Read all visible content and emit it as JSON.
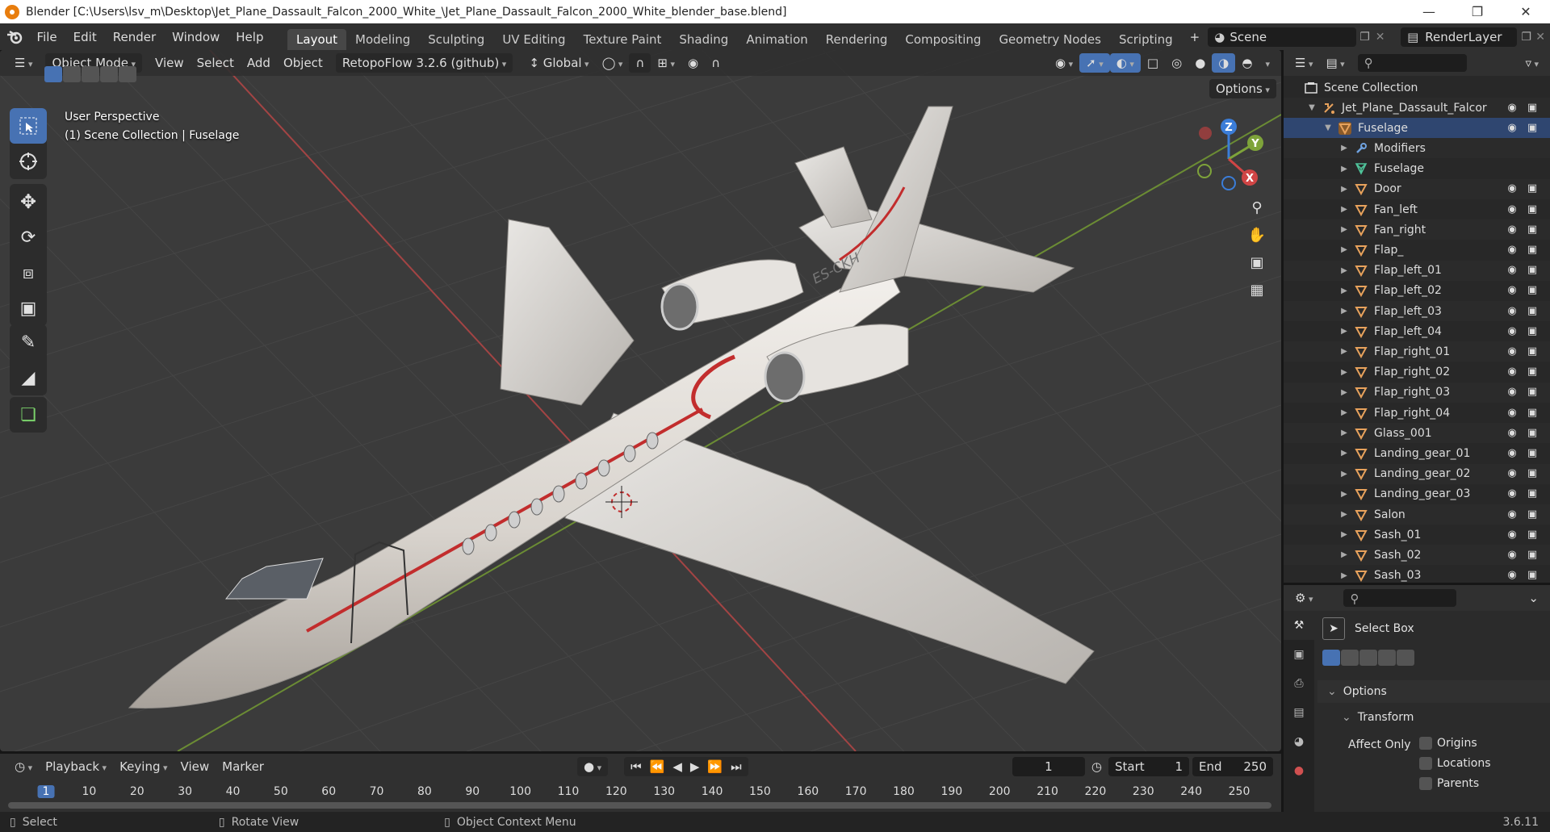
{
  "window": {
    "title": "Blender [C:\\Users\\lsv_m\\Desktop\\Jet_Plane_Dassault_Falcon_2000_White_\\Jet_Plane_Dassault_Falcon_2000_White_blender_base.blend]",
    "minimize": "—",
    "restore": "❐",
    "close": "✕"
  },
  "menus": [
    "File",
    "Edit",
    "Render",
    "Window",
    "Help"
  ],
  "workspaces": [
    "Layout",
    "Modeling",
    "Sculpting",
    "UV Editing",
    "Texture Paint",
    "Shading",
    "Animation",
    "Rendering",
    "Compositing",
    "Geometry Nodes",
    "Scripting"
  ],
  "add_workspace": "+",
  "scene": {
    "label": "Scene",
    "render_layer": "RenderLayer"
  },
  "viewport": {
    "mode": "Object Mode",
    "view": "View",
    "select": "Select",
    "add": "Add",
    "object": "Object",
    "addon": "RetopoFlow 3.2.6 (github)",
    "orientation": "Global",
    "options": "Options",
    "perspective": "User Perspective",
    "collection_info": "(1) Scene Collection | Fuselage",
    "registration": "ES-CKH",
    "gizmo": {
      "x": "X",
      "y": "Y",
      "z": "Z"
    },
    "colors": {
      "x_axis": "#d04545",
      "y_axis": "#7ea33a",
      "z_axis": "#3b7dd8",
      "grid": "#454545",
      "bg": "#3b3b3b"
    }
  },
  "outliner": {
    "search_placeholder": "",
    "root": "Scene Collection",
    "rows": [
      {
        "name": "Jet_Plane_Dassault_Falcor",
        "indent": 1,
        "type": "collection",
        "expanded": true
      },
      {
        "name": "Fuselage",
        "indent": 2,
        "type": "object",
        "expanded": true,
        "selected": true
      },
      {
        "name": "Modifiers",
        "indent": 3,
        "type": "modifiers"
      },
      {
        "name": "Fuselage",
        "indent": 3,
        "type": "mesh"
      },
      {
        "name": "Door",
        "indent": 3,
        "type": "object"
      },
      {
        "name": "Fan_left",
        "indent": 3,
        "type": "object"
      },
      {
        "name": "Fan_right",
        "indent": 3,
        "type": "object"
      },
      {
        "name": "Flap_",
        "indent": 3,
        "type": "object"
      },
      {
        "name": "Flap_left_01",
        "indent": 3,
        "type": "object"
      },
      {
        "name": "Flap_left_02",
        "indent": 3,
        "type": "object"
      },
      {
        "name": "Flap_left_03",
        "indent": 3,
        "type": "object"
      },
      {
        "name": "Flap_left_04",
        "indent": 3,
        "type": "object"
      },
      {
        "name": "Flap_right_01",
        "indent": 3,
        "type": "object"
      },
      {
        "name": "Flap_right_02",
        "indent": 3,
        "type": "object"
      },
      {
        "name": "Flap_right_03",
        "indent": 3,
        "type": "object"
      },
      {
        "name": "Flap_right_04",
        "indent": 3,
        "type": "object"
      },
      {
        "name": "Glass_001",
        "indent": 3,
        "type": "object"
      },
      {
        "name": "Landing_gear_01",
        "indent": 3,
        "type": "object"
      },
      {
        "name": "Landing_gear_02",
        "indent": 3,
        "type": "object"
      },
      {
        "name": "Landing_gear_03",
        "indent": 3,
        "type": "object"
      },
      {
        "name": "Salon",
        "indent": 3,
        "type": "object"
      },
      {
        "name": "Sash_01",
        "indent": 3,
        "type": "object"
      },
      {
        "name": "Sash_02",
        "indent": 3,
        "type": "object"
      },
      {
        "name": "Sash_03",
        "indent": 3,
        "type": "object"
      }
    ]
  },
  "properties": {
    "active_tool": "Select Box",
    "options_header": "Options",
    "transform_header": "Transform",
    "affect_only": "Affect Only",
    "origins": "Origins",
    "locations": "Locations",
    "parents": "Parents"
  },
  "timeline": {
    "playback": "Playback",
    "keying": "Keying",
    "view": "View",
    "marker": "Marker",
    "current_frame": "1",
    "start_label": "Start",
    "start": "1",
    "end_label": "End",
    "end": "250",
    "ticks": [
      "1",
      "10",
      "20",
      "30",
      "40",
      "50",
      "60",
      "70",
      "80",
      "90",
      "100",
      "110",
      "120",
      "130",
      "140",
      "150",
      "160",
      "170",
      "180",
      "190",
      "200",
      "210",
      "220",
      "230",
      "240",
      "250"
    ]
  },
  "status": {
    "select": "Select",
    "rotate": "Rotate View",
    "context": "Object Context Menu",
    "version": "3.6.11"
  }
}
